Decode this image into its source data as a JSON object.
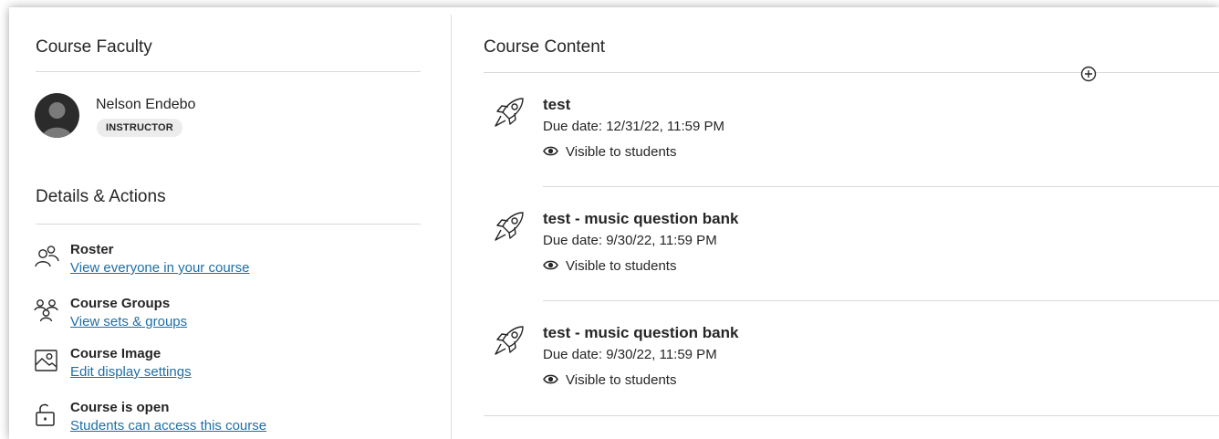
{
  "faculty": {
    "title": "Course Faculty",
    "name": "Nelson Endebo",
    "role": "INSTRUCTOR"
  },
  "details": {
    "title": "Details & Actions",
    "items": [
      {
        "label": "Roster",
        "link": "View everyone in your course",
        "icon": "people-icon"
      },
      {
        "label": "Course Groups",
        "link": "View sets & groups",
        "icon": "groups-icon"
      },
      {
        "label": "Course Image",
        "link": "Edit display settings",
        "icon": "image-icon"
      },
      {
        "label": "Course is open",
        "link": "Students can access this course",
        "icon": "unlock-icon"
      }
    ]
  },
  "content": {
    "title": "Course Content",
    "items": [
      {
        "title": "test",
        "due": "Due date: 12/31/22, 11:59 PM",
        "visibility": "Visible to students",
        "icon": "rocket-icon"
      },
      {
        "title": "test - music question bank",
        "due": "Due date: 9/30/22, 11:59 PM",
        "visibility": "Visible to students",
        "icon": "rocket-icon"
      },
      {
        "title": "test - music question bank",
        "due": "Due date: 9/30/22, 11:59 PM",
        "visibility": "Visible to students",
        "icon": "rocket-icon"
      }
    ]
  },
  "colors": {
    "link": "#1f6fa6",
    "text": "#262626",
    "divider": "#d9d9d9",
    "badge_bg": "#ececec"
  }
}
